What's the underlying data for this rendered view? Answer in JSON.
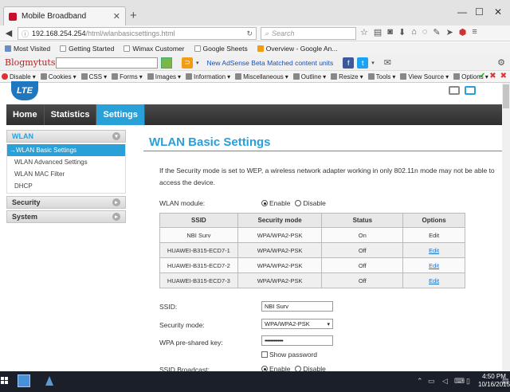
{
  "browser": {
    "tab_title": "Mobile Broadband",
    "url_host": "192.168.254.254",
    "url_path": "/html/wlanbasicsettings.html",
    "search_placeholder": "Search",
    "bookmarks": [
      "Most Visited",
      "Getting Started",
      "Wimax Customer",
      "Google Sheets",
      "Overview - Google An..."
    ],
    "toolbar2": {
      "brand": "Blogmytuts",
      "adsense_link": "New AdSense Beta Matched content units"
    },
    "webdev": [
      "Disable",
      "Cookies",
      "CSS",
      "Forms",
      "Images",
      "Information",
      "Miscellaneous",
      "Outline",
      "Resize",
      "Tools",
      "View Source",
      "Options"
    ]
  },
  "router": {
    "logo_text": "LTE",
    "nav": [
      "Home",
      "Statistics",
      "Settings"
    ],
    "active_nav": "Settings",
    "sidebar": {
      "wlan": {
        "label": "WLAN",
        "items": [
          "WLAN Basic Settings",
          "WLAN Advanced Settings",
          "WLAN MAC Filter",
          "DHCP"
        ]
      },
      "security": "Security",
      "system": "System"
    },
    "page_title": "WLAN Basic Settings",
    "note": "If the Security mode is set to WEP, a wireless network adapter working in only 802.11n mode may not be able to access the device.",
    "wlan_module": {
      "label": "WLAN module:",
      "enable": "Enable",
      "disable": "Disable",
      "selected": "Enable"
    },
    "table": {
      "headers": [
        "SSID",
        "Security mode",
        "Status",
        "Options"
      ],
      "rows": [
        {
          "ssid": "NBI Surv",
          "mode": "WPA/WPA2-PSK",
          "status": "On",
          "option": "Edit",
          "link": false
        },
        {
          "ssid": "HUAWEI-B315-ECD7-1",
          "mode": "WPA/WPA2-PSK",
          "status": "Off",
          "option": "Edit",
          "link": true
        },
        {
          "ssid": "HUAWEI-B315-ECD7-2",
          "mode": "WPA/WPA2-PSK",
          "status": "Off",
          "option": "Edit",
          "link": true
        },
        {
          "ssid": "HUAWEI-B315-ECD7-3",
          "mode": "WPA/WPA2-PSK",
          "status": "Off",
          "option": "Edit",
          "link": true
        }
      ]
    },
    "form": {
      "ssid_label": "SSID:",
      "ssid_value": "NBI Surv",
      "security_label": "Security mode:",
      "security_value": "WPA/WPA2-PSK",
      "wpa_label": "WPA pre-shared key:",
      "wpa_value": "••••••••••••••",
      "show_password": "Show password",
      "broadcast_label": "SSID Broadcast:",
      "broadcast_enable": "Enable",
      "broadcast_disable": "Disable"
    }
  },
  "taskbar": {
    "time": "4:50 PM",
    "date": "10/16/2015"
  }
}
